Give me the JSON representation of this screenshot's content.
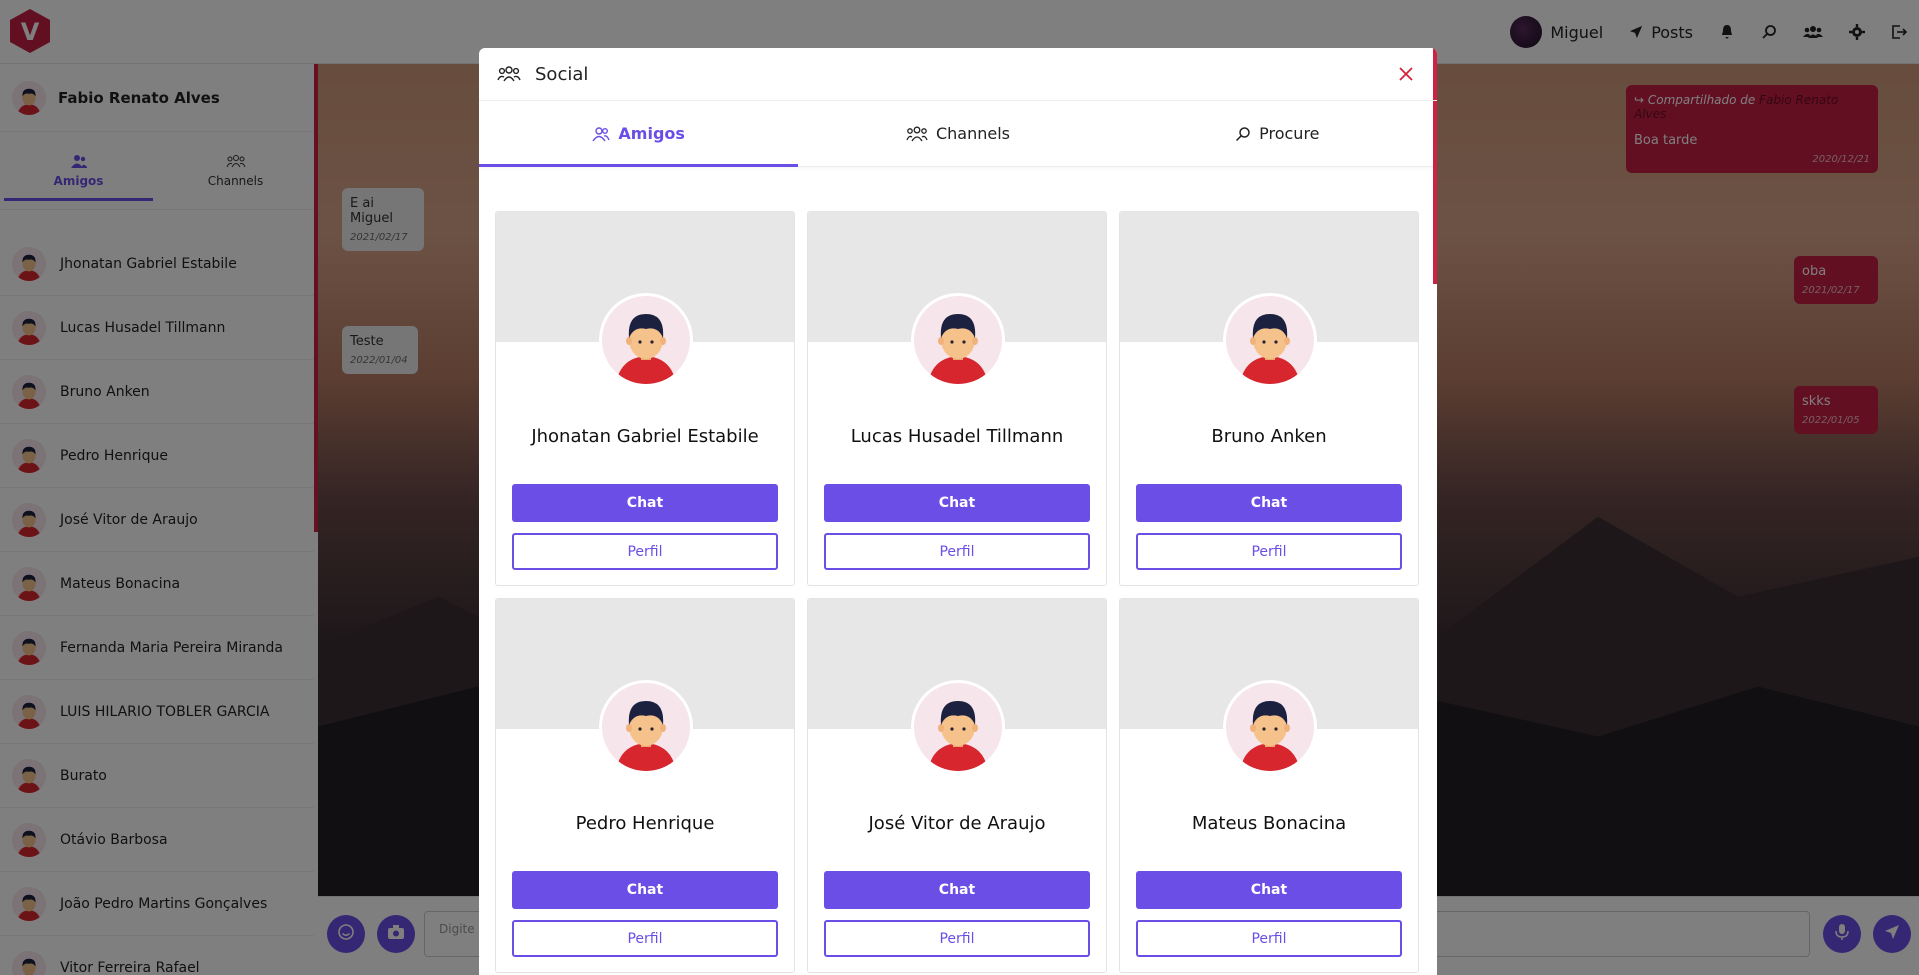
{
  "topbar": {
    "user_name": "Miguel",
    "posts_label": "Posts",
    "icons": [
      "bell-icon",
      "search-icon",
      "users-icon",
      "gear-icon",
      "logout-icon"
    ]
  },
  "sidebar": {
    "current_user": "Fabio Renato Alves",
    "tabs": [
      {
        "label": "Amigos",
        "icon": "friends-icon"
      },
      {
        "label": "Channels",
        "icon": "group-icon"
      }
    ],
    "friends": [
      "Jhonatan Gabriel Estabile",
      "Lucas Husadel Tillmann",
      "Bruno Anken",
      "Pedro Henrique",
      "José Vitor de Araujo",
      "Mateus Bonacina",
      "Fernanda Maria Pereira Miranda",
      "LUIS HILARIO TOBLER GARCIA",
      "Burato",
      "Otávio Barbosa",
      "João Pedro Martins Gonçalves",
      "Vitor Ferreira Rafael"
    ]
  },
  "chat": {
    "messages_in": [
      {
        "text": "E ai Miguel",
        "date": "2021/02/17"
      },
      {
        "text": "Teste",
        "date": "2022/01/04"
      }
    ],
    "messages_out": [
      {
        "shared_prefix": "Compartilhado de",
        "shared_from": "Fabio Renato Alves",
        "text": "Boa tarde",
        "date": "2020/12/21"
      },
      {
        "text": "oba",
        "date": "2021/02/17"
      },
      {
        "text": "skks",
        "date": "2022/01/05"
      }
    ],
    "composer_placeholder": "Digite s"
  },
  "modal": {
    "title": "Social",
    "tabs": [
      {
        "label": "Amigos",
        "icon": "friends-icon"
      },
      {
        "label": "Channels",
        "icon": "group-icon"
      },
      {
        "label": "Procure",
        "icon": "search-icon"
      }
    ],
    "cards": [
      {
        "name": "Jhonatan Gabriel Estabile",
        "chat": "Chat",
        "perfil": "Perfil"
      },
      {
        "name": "Lucas Husadel Tillmann",
        "chat": "Chat",
        "perfil": "Perfil"
      },
      {
        "name": "Bruno Anken",
        "chat": "Chat",
        "perfil": "Perfil"
      },
      {
        "name": "Pedro Henrique",
        "chat": "Chat",
        "perfil": "Perfil"
      },
      {
        "name": "José Vitor de Araujo",
        "chat": "Chat",
        "perfil": "Perfil"
      },
      {
        "name": "Mateus Bonacina",
        "chat": "Chat",
        "perfil": "Perfil"
      }
    ]
  },
  "colors": {
    "accent": "#6b4ee6",
    "brand_red": "#c41f42",
    "cover_gray": "#e7e7e7"
  }
}
